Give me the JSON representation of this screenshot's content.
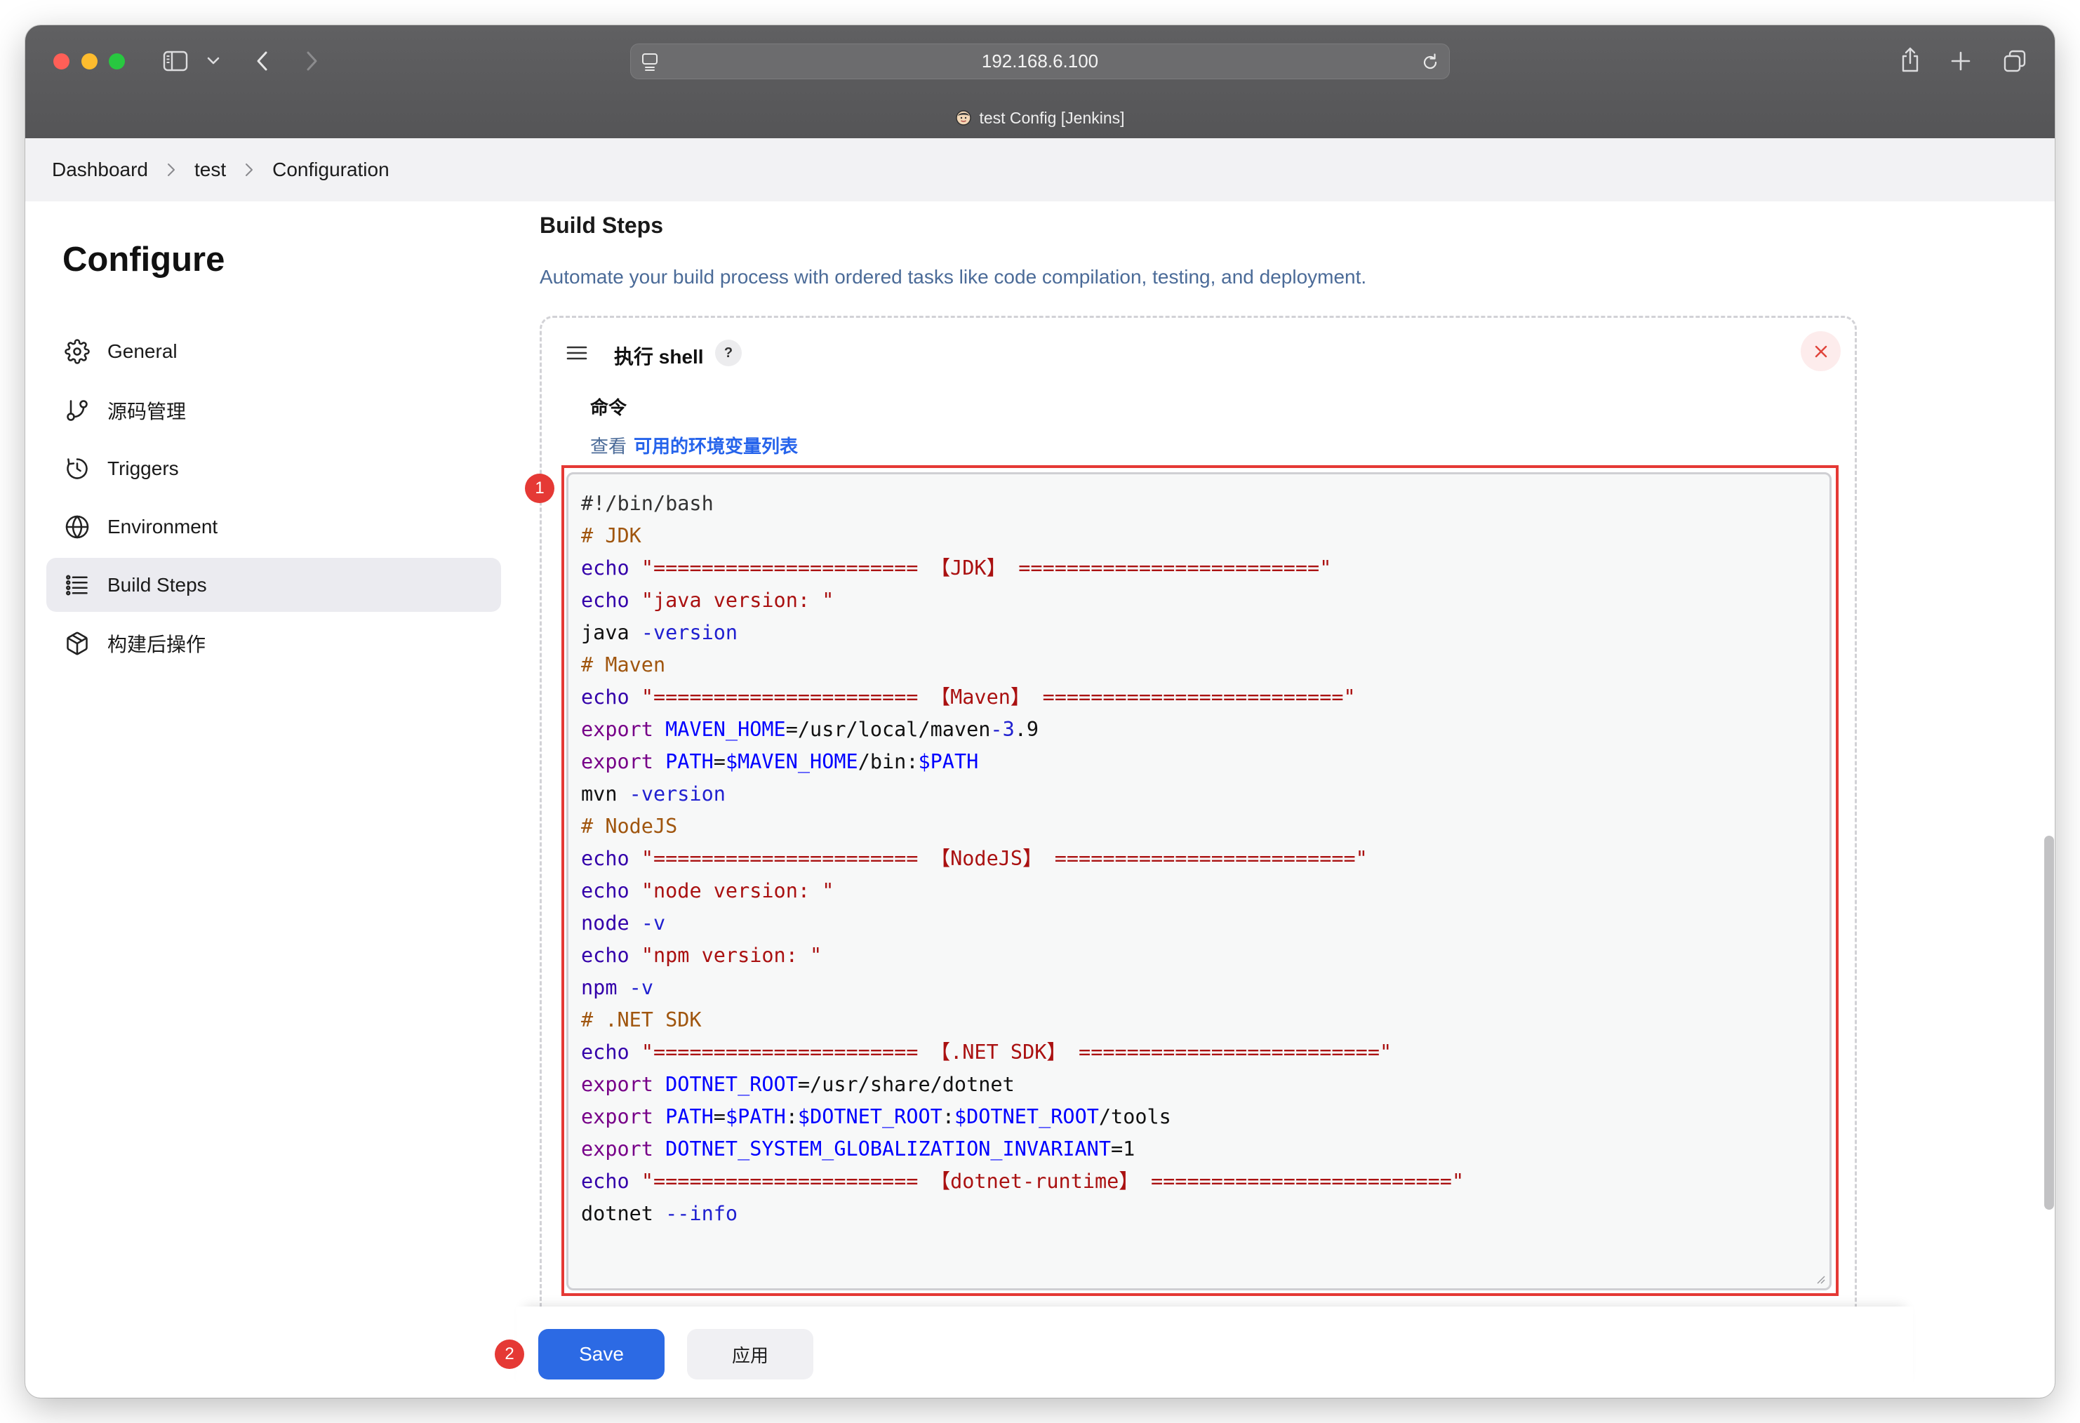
{
  "browser": {
    "url": "192.168.6.100",
    "tab_title": "test Config [Jenkins]",
    "traffic_light_colors": [
      "#ff5f57",
      "#febc2e",
      "#28c840"
    ]
  },
  "breadcrumb": [
    "Dashboard",
    "test",
    "Configuration"
  ],
  "sidebar": {
    "title": "Configure",
    "items": [
      {
        "label": "General",
        "icon": "gear-icon",
        "active": false
      },
      {
        "label": "源码管理",
        "icon": "git-branch-icon",
        "active": false
      },
      {
        "label": "Triggers",
        "icon": "timer-icon",
        "active": false
      },
      {
        "label": "Environment",
        "icon": "globe-icon",
        "active": false
      },
      {
        "label": "Build Steps",
        "icon": "list-icon",
        "active": true
      },
      {
        "label": "构建后操作",
        "icon": "package-icon",
        "active": false
      }
    ]
  },
  "main": {
    "section_title": "Build Steps",
    "section_description": "Automate your build process with ordered tasks like code compilation, testing, and deployment.",
    "step": {
      "title": "执行 shell",
      "help": "?",
      "command_label": "命令",
      "env_prefix": "查看",
      "env_link": "可用的环境变量列表",
      "editor": {
        "lines": [
          [
            [
              "#!/bin/bash",
              "meta"
            ]
          ],
          [
            [
              "# JDK",
              "comment"
            ]
          ],
          [
            [
              "echo",
              "builtin"
            ],
            [
              " ",
              "plain"
            ],
            [
              "\"====================== 【JDK】 =========================\"",
              "string"
            ]
          ],
          [
            [
              "echo",
              "builtin"
            ],
            [
              " ",
              "plain"
            ],
            [
              "\"java version: \"",
              "string"
            ]
          ],
          [
            [
              "java",
              "plain"
            ],
            [
              " ",
              "plain"
            ],
            [
              "-version",
              "attribute"
            ]
          ],
          [
            [
              "# Maven",
              "comment"
            ]
          ],
          [
            [
              "echo",
              "builtin"
            ],
            [
              " ",
              "plain"
            ],
            [
              "\"====================== 【Maven】 =========================\"",
              "string"
            ]
          ],
          [
            [
              "export",
              "keyword"
            ],
            [
              " ",
              "plain"
            ],
            [
              "MAVEN_HOME",
              "def"
            ],
            [
              "=/usr/local/maven",
              "plain"
            ],
            [
              "-3",
              "attribute"
            ],
            [
              ".9",
              "plain"
            ]
          ],
          [
            [
              "export",
              "keyword"
            ],
            [
              " ",
              "plain"
            ],
            [
              "PATH",
              "def"
            ],
            [
              "=",
              "plain"
            ],
            [
              "$MAVEN_HOME",
              "def"
            ],
            [
              "/bin:",
              "plain"
            ],
            [
              "$PATH",
              "def"
            ]
          ],
          [
            [
              "mvn",
              "plain"
            ],
            [
              " ",
              "plain"
            ],
            [
              "-version",
              "attribute"
            ]
          ],
          [
            [
              "# NodeJS",
              "comment"
            ]
          ],
          [
            [
              "echo",
              "builtin"
            ],
            [
              " ",
              "plain"
            ],
            [
              "\"====================== 【NodeJS】 =========================\"",
              "string"
            ]
          ],
          [
            [
              "echo",
              "builtin"
            ],
            [
              " ",
              "plain"
            ],
            [
              "\"node version: \"",
              "string"
            ]
          ],
          [
            [
              "node",
              "builtin"
            ],
            [
              " ",
              "plain"
            ],
            [
              "-v",
              "attribute"
            ]
          ],
          [
            [
              "echo",
              "builtin"
            ],
            [
              " ",
              "plain"
            ],
            [
              "\"npm version: \"",
              "string"
            ]
          ],
          [
            [
              "npm",
              "builtin"
            ],
            [
              " ",
              "plain"
            ],
            [
              "-v",
              "attribute"
            ]
          ],
          [
            [
              "# .NET SDK",
              "comment"
            ]
          ],
          [
            [
              "echo",
              "builtin"
            ],
            [
              " ",
              "plain"
            ],
            [
              "\"====================== 【.NET SDK】 =========================\"",
              "string"
            ]
          ],
          [
            [
              "export",
              "keyword"
            ],
            [
              " ",
              "plain"
            ],
            [
              "DOTNET_ROOT",
              "def"
            ],
            [
              "=/usr/share/dotnet",
              "plain"
            ]
          ],
          [
            [
              "export",
              "keyword"
            ],
            [
              " ",
              "plain"
            ],
            [
              "PATH",
              "def"
            ],
            [
              "=",
              "plain"
            ],
            [
              "$PATH",
              "def"
            ],
            [
              ":",
              "plain"
            ],
            [
              "$DOTNET_ROOT",
              "def"
            ],
            [
              ":",
              "plain"
            ],
            [
              "$DOTNET_ROOT",
              "def"
            ],
            [
              "/tools",
              "plain"
            ]
          ],
          [
            [
              "export",
              "keyword"
            ],
            [
              " ",
              "plain"
            ],
            [
              "DOTNET_SYSTEM_GLOBALIZATION_INVARIANT",
              "def"
            ],
            [
              "=1",
              "plain"
            ]
          ],
          [
            [
              "echo",
              "builtin"
            ],
            [
              " ",
              "plain"
            ],
            [
              "\"====================== 【dotnet-runtime】 =========================\"",
              "string"
            ]
          ],
          [
            [
              "dotnet",
              "plain"
            ],
            [
              " ",
              "plain"
            ],
            [
              "--info",
              "attribute"
            ]
          ]
        ]
      }
    }
  },
  "footer": {
    "save_label": "Save",
    "apply_label": "应用"
  },
  "annotations": [
    "1",
    "2"
  ],
  "colors": {
    "primary_button": "#2c6ae4",
    "annotation_red": "#e53935",
    "link": "#2563eb",
    "active_nav_bg": "#ebebf0"
  },
  "syntax_colors": {
    "plain": "#111111",
    "meta": "#333333",
    "comment": "#a0560f",
    "builtin": "#3300aa",
    "keyword": "#770088",
    "def": "#0000ff",
    "attribute": "#2020d0",
    "string": "#aa1111"
  }
}
